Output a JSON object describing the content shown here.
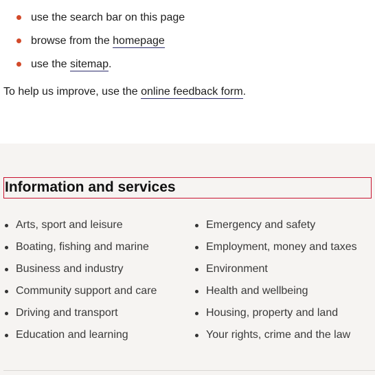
{
  "suggestions": {
    "item_1": "use the search bar on this page",
    "item_2_prefix": "browse from the ",
    "item_2_link": "homepage",
    "item_3_prefix": "use the ",
    "item_3_link": "sitemap",
    "item_3_suffix": "."
  },
  "feedback": {
    "prefix": "To help us improve, use the ",
    "link": "online feedback form",
    "suffix": "."
  },
  "info_section": {
    "heading": "Information and services",
    "left_column": [
      "Arts, sport and leisure",
      "Boating, fishing and marine",
      "Business and industry",
      "Community support and care",
      "Driving and transport",
      "Education and learning"
    ],
    "right_column": [
      "Emergency and safety",
      "Employment, money and taxes",
      "Environment",
      "Health and wellbeing",
      "Housing, property and land",
      "Your rights, crime and the law"
    ]
  },
  "colors": {
    "bullet_accent": "#d24a2a",
    "focus_outline": "#c8102e",
    "section_background": "#f6f4f2"
  }
}
